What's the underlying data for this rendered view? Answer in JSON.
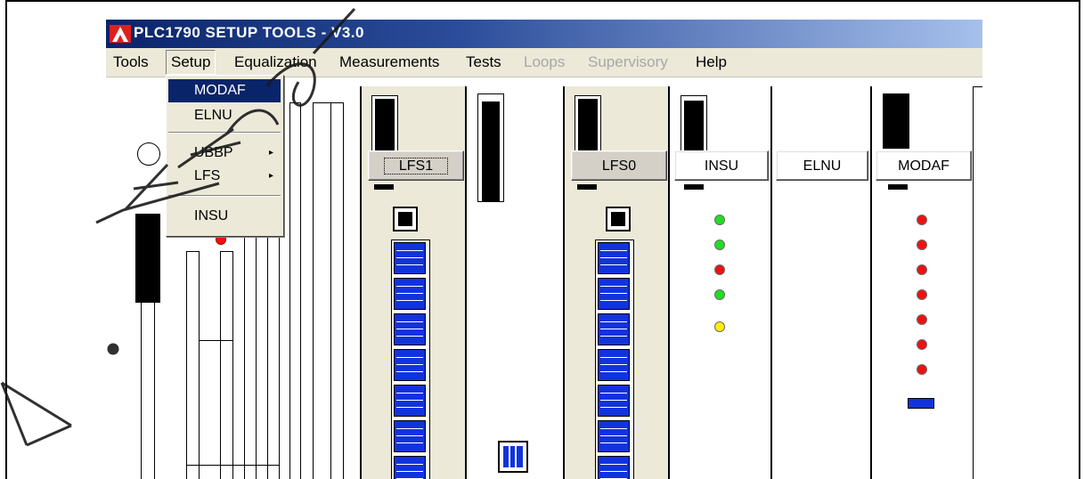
{
  "window": {
    "title": "PLC1790 SETUP TOOLS  -  V3.0",
    "icon": "app-logo-a-icon"
  },
  "menubar": {
    "items": [
      {
        "label": "Tools",
        "state": "normal"
      },
      {
        "label": "Setup",
        "state": "open"
      },
      {
        "label": "Equalization",
        "state": "normal"
      },
      {
        "label": "Measurements",
        "state": "normal"
      },
      {
        "label": "Tests",
        "state": "normal"
      },
      {
        "label": "Loops",
        "state": "disabled"
      },
      {
        "label": "Supervisory",
        "state": "disabled"
      },
      {
        "label": "Help",
        "state": "normal"
      }
    ]
  },
  "setup_menu": {
    "items": [
      {
        "label": "MODAF",
        "highlighted": true,
        "submenu": false
      },
      {
        "label": "ELNU",
        "highlighted": false,
        "submenu": false
      },
      {
        "label": "UBBP",
        "highlighted": false,
        "submenu": true
      },
      {
        "label": "LFS",
        "highlighted": false,
        "submenu": true
      },
      {
        "label": "INSU",
        "highlighted": false,
        "submenu": false
      }
    ],
    "submenu_arrow": "▸"
  },
  "rack": {
    "buttons": [
      {
        "label": "LFS1"
      },
      {
        "label": "LFS0"
      },
      {
        "label": "INSU"
      },
      {
        "label": "ELNU"
      },
      {
        "label": "MODAF"
      }
    ],
    "insu_leds": [
      "green",
      "green",
      "red",
      "green",
      "yellow"
    ],
    "modaf_leds": [
      "red",
      "red",
      "red",
      "red",
      "red",
      "red",
      "red"
    ],
    "ubbp_led": "red"
  },
  "colors": {
    "title_start": "#0a246a",
    "title_end": "#a6c0ec",
    "menu_highlight": "#0a246a",
    "module_blue": "#1133dd",
    "led_green": "#22dd22",
    "led_red": "#ee1111",
    "led_yellow": "#ffee00",
    "watermark": "#1a1a1a"
  }
}
